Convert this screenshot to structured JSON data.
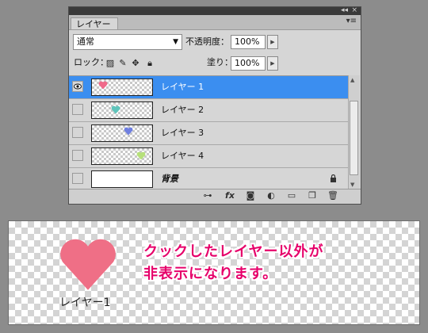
{
  "panel": {
    "tab_label": "レイヤー",
    "blend_mode": "通常",
    "opacity_label": "不透明度：",
    "opacity_value": "100%",
    "lock_label": "ロック：",
    "fill_label": "塗り：",
    "fill_value": "100%",
    "layers": [
      {
        "name": "レイヤー 1",
        "visible": true,
        "selected": true,
        "heart_color": "#f06a8a"
      },
      {
        "name": "レイヤー 2",
        "visible": false,
        "selected": false,
        "heart_color": "#5fc4bb"
      },
      {
        "name": "レイヤー 3",
        "visible": false,
        "selected": false,
        "heart_color": "#6f7fe0"
      },
      {
        "name": "レイヤー 4",
        "visible": false,
        "selected": false,
        "heart_color": "#b6e07a"
      },
      {
        "name": "背景",
        "visible": false,
        "selected": false,
        "locked": true
      }
    ]
  },
  "stage": {
    "heart_color": "#ef6f86",
    "label": "レイヤー1",
    "callout_line1": "クックしたレイヤー以外が",
    "callout_line2": "非表示になります。"
  }
}
